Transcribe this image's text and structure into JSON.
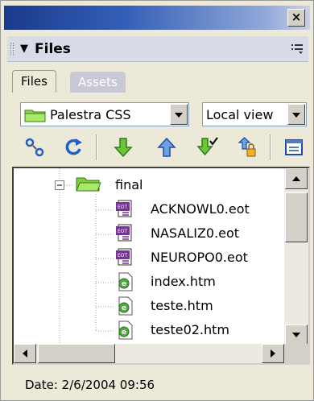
{
  "panel": {
    "title": "Files",
    "tabs": [
      {
        "label": "Files"
      },
      {
        "label": "Assets"
      }
    ]
  },
  "site_select": {
    "value": "Palestra CSS"
  },
  "view_select": {
    "value": "Local view"
  },
  "toolbar": {
    "buttons": [
      "connect-icon",
      "refresh-icon",
      "get-icon",
      "put-icon",
      "check-out-icon",
      "check-in-icon",
      "expand-icon"
    ]
  },
  "tree": {
    "folder": {
      "name": "final",
      "expanded": true
    },
    "items": [
      {
        "name": "ACKNOWL0.eot",
        "type": "eot"
      },
      {
        "name": "NASALIZ0.eot",
        "type": "eot"
      },
      {
        "name": "NEUROPO0.eot",
        "type": "eot"
      },
      {
        "name": "index.htm",
        "type": "htm"
      },
      {
        "name": "teste.htm",
        "type": "htm"
      },
      {
        "name": "teste02.htm",
        "type": "htm"
      }
    ]
  },
  "status": {
    "text": "Date: 2/6/2004 09:56"
  },
  "colors": {
    "accent": "#1a3a8c",
    "folder": "#7ccd3a",
    "eot": "#7a2f9c",
    "htm": "#4caf3a"
  }
}
